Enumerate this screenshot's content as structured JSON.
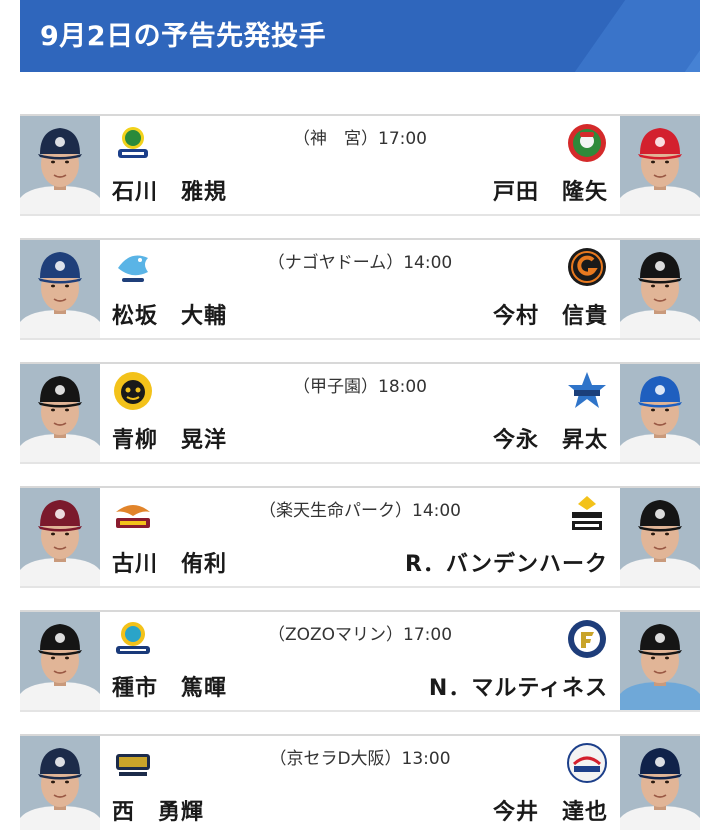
{
  "header": {
    "title": "9月2日の予告先発投手"
  },
  "colors": {
    "header_bg": "#2f66bc"
  },
  "games": [
    {
      "venue": "（神　宮）17:00",
      "home": {
        "pitcher": "石川　雅規",
        "team_logo": "swallows-logo",
        "cap_color": "#1c2b4a",
        "jersey": "#f3f3f3"
      },
      "away": {
        "pitcher": "戸田　隆矢",
        "team_logo": "carp-logo",
        "cap_color": "#d3202e",
        "jersey": "#f3f3f3"
      }
    },
    {
      "venue": "（ナゴヤドーム）14:00",
      "home": {
        "pitcher": "松坂　大輔",
        "team_logo": "dragons-logo",
        "cap_color": "#1f3f7a",
        "jersey": "#f3f3f3"
      },
      "away": {
        "pitcher": "今村　信貴",
        "team_logo": "giants-logo",
        "cap_color": "#151515",
        "jersey": "#f3f3f3"
      }
    },
    {
      "venue": "（甲子園）18:00",
      "home": {
        "pitcher": "青柳　晃洋",
        "team_logo": "tigers-logo",
        "cap_color": "#151515",
        "jersey": "#f3f3f3"
      },
      "away": {
        "pitcher": "今永　昇太",
        "team_logo": "baystars-logo",
        "cap_color": "#1f5fbf",
        "jersey": "#f3f3f3"
      }
    },
    {
      "venue": "（楽天生命パーク）14:00",
      "home": {
        "pitcher": "古川　侑利",
        "team_logo": "eagles-logo",
        "cap_color": "#7b1a2c",
        "jersey": "#f3f3f3"
      },
      "away": {
        "pitcher": "R．バンデンハーク",
        "team_logo": "hawks-logo",
        "cap_color": "#151515",
        "jersey": "#f3f3f3"
      }
    },
    {
      "venue": "（ZOZOマリン）17:00",
      "home": {
        "pitcher": "種市　篤暉",
        "team_logo": "marines-logo",
        "cap_color": "#151515",
        "jersey": "#f3f3f3"
      },
      "away": {
        "pitcher": "N．マルティネス",
        "team_logo": "fighters-logo",
        "cap_color": "#151515",
        "jersey": "#6fa8d8"
      }
    },
    {
      "venue": "（京セラD大阪）13:00",
      "home": {
        "pitcher": "西　勇輝",
        "team_logo": "buffaloes-logo",
        "cap_color": "#1c2b4a",
        "jersey": "#f3f3f3"
      },
      "away": {
        "pitcher": "今井　達也",
        "team_logo": "lions-logo",
        "cap_color": "#10224a",
        "jersey": "#f3f3f3"
      }
    }
  ]
}
